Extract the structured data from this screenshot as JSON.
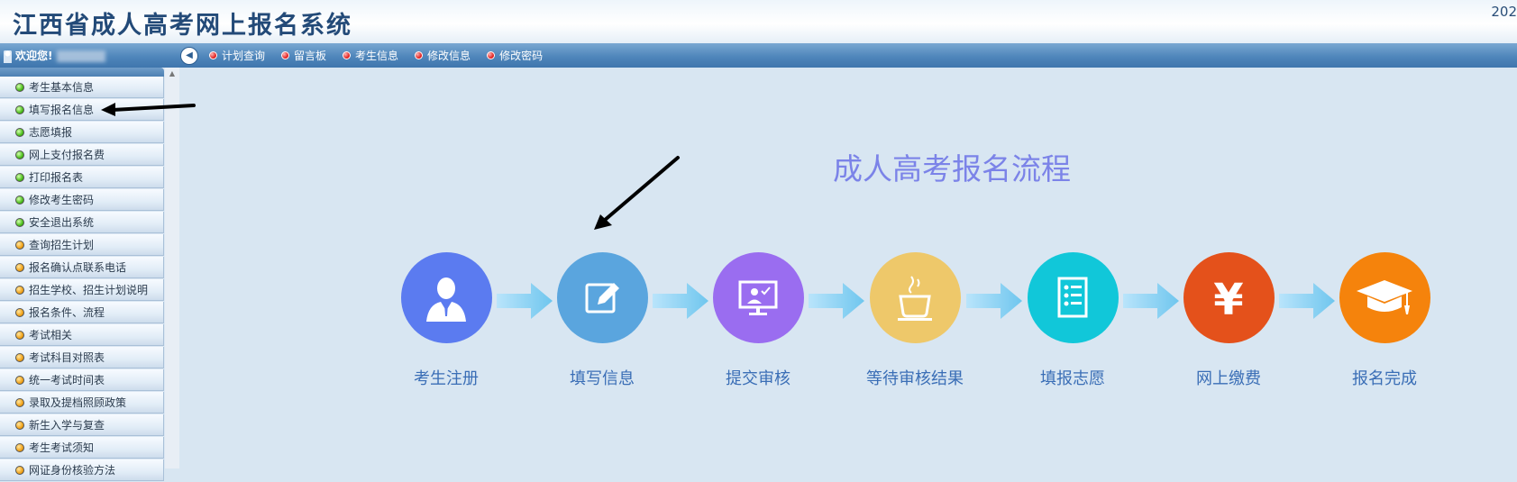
{
  "header": {
    "title": "江西省成人高考网上报名系统",
    "date_fragment": "202"
  },
  "navbar": {
    "welcome": "欢迎您!",
    "menu": [
      "计划查询",
      "留言板",
      "考生信息",
      "修改信息",
      "修改密码"
    ]
  },
  "sidebar": {
    "items": [
      {
        "label": "考生基本信息",
        "dot": "green"
      },
      {
        "label": "填写报名信息",
        "dot": "green"
      },
      {
        "label": "志愿填报",
        "dot": "green"
      },
      {
        "label": "网上支付报名费",
        "dot": "green"
      },
      {
        "label": "打印报名表",
        "dot": "green"
      },
      {
        "label": "修改考生密码",
        "dot": "green"
      },
      {
        "label": "安全退出系统",
        "dot": "green"
      },
      {
        "label": "查询招生计划",
        "dot": "orange"
      },
      {
        "label": "报名确认点联系电话",
        "dot": "orange"
      },
      {
        "label": "招生学校、招生计划说明",
        "dot": "orange"
      },
      {
        "label": "报名条件、流程",
        "dot": "orange"
      },
      {
        "label": "考试相关",
        "dot": "orange"
      },
      {
        "label": "考试科目对照表",
        "dot": "orange"
      },
      {
        "label": "统一考试时间表",
        "dot": "orange"
      },
      {
        "label": "录取及提档照顾政策",
        "dot": "orange"
      },
      {
        "label": "新生入学与复查",
        "dot": "orange"
      },
      {
        "label": "考生考试须知",
        "dot": "orange"
      },
      {
        "label": "网证身份核验方法",
        "dot": "orange"
      }
    ]
  },
  "flow": {
    "title": "成人高考报名流程",
    "steps": [
      {
        "label": "考生注册",
        "color": "#5b7bf0",
        "icon": "user-icon"
      },
      {
        "label": "填写信息",
        "color": "#5aa5de",
        "icon": "edit-icon"
      },
      {
        "label": "提交审核",
        "color": "#9a6df0",
        "icon": "monitor-check-icon"
      },
      {
        "label": "等待审核结果",
        "color": "#eec86a",
        "icon": "coffee-cup-icon"
      },
      {
        "label": "填报志愿",
        "color": "#11c7d9",
        "icon": "checklist-icon"
      },
      {
        "label": "网上缴费",
        "color": "#e4511b",
        "icon": "yen-icon"
      },
      {
        "label": "报名完成",
        "color": "#f5830c",
        "icon": "graduation-cap-icon"
      }
    ]
  },
  "colors": {
    "background": "#d8e6f2",
    "navbar": "#4f86bb",
    "title_text": "#234a78",
    "flow_title": "#7b83e8",
    "step_label": "#3a6eb6",
    "annotation_arrow": "#000000"
  }
}
